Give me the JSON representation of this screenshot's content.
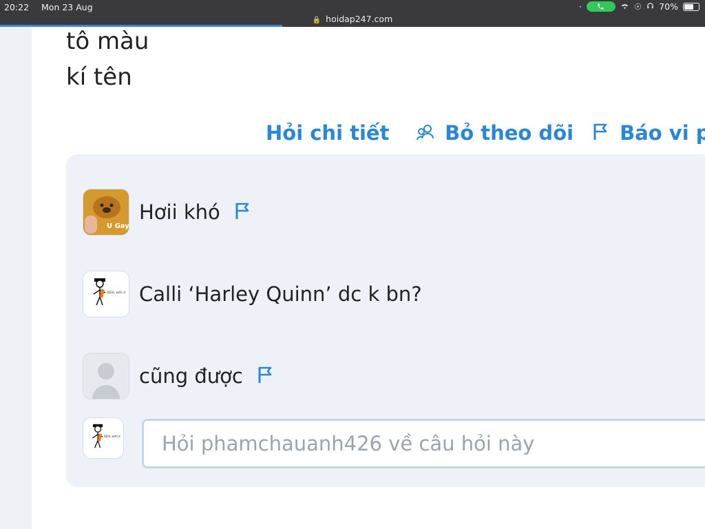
{
  "status_bar": {
    "time": "20:22",
    "date": "Mon 23 Aug",
    "url": "hoidap247.com",
    "battery": "70%",
    "battery_level": 0.7
  },
  "post": {
    "lines": [
      "tô màu",
      "kí tên"
    ]
  },
  "actions": {
    "ask_detail": "Hỏi chi tiết",
    "unfollow": "Bỏ theo dõi",
    "report": "Báo vi ph"
  },
  "comments": [
    {
      "text": "Hơii khó",
      "avatar_label": "U Gay",
      "flag": true
    },
    {
      "text": "Calli ‘Harley Quinn’ dc k bn?",
      "avatar_label": "DEAL with it",
      "flag": false
    },
    {
      "text": "cũng được",
      "avatar_label": "",
      "flag": true
    }
  ],
  "ask_input": {
    "placeholder": "Hỏi phamchauanh426 về câu hỏi này",
    "avatar_label": "DEAL with it"
  },
  "colors": {
    "accent": "#2b86d8",
    "status_bg": "#3a3a3c",
    "comments_bg": "#eef2f8"
  }
}
